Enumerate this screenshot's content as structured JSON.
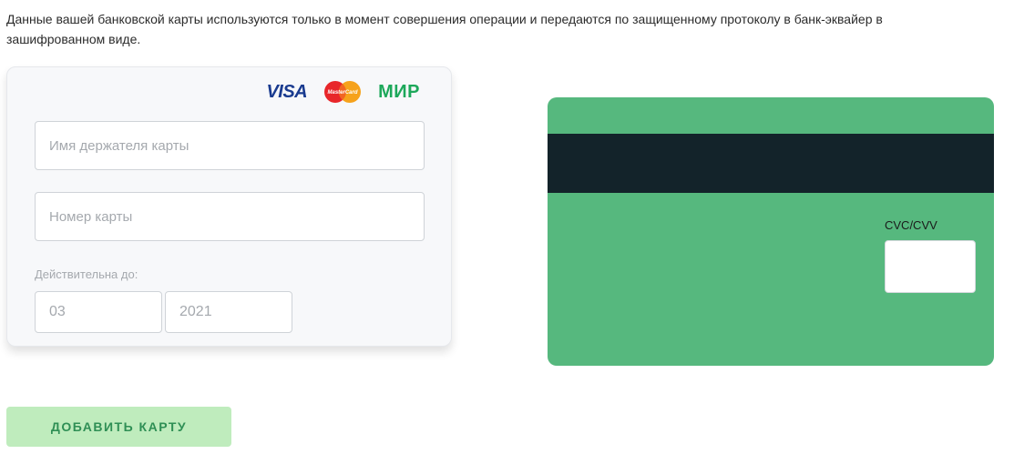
{
  "notice": {
    "text": "Данные вашей банковской карты используются только в момент совершения операции и передаются по защищенному протоколу в банк-эквайер в зашифрованном виде."
  },
  "front_card": {
    "logos": {
      "visa": "VISA",
      "mastercard": "MasterCard",
      "mir": "МИР"
    },
    "holder_field": {
      "placeholder": "Имя держателя карты",
      "value": ""
    },
    "number_field": {
      "placeholder": "Номер карты",
      "value": ""
    },
    "valid_label": "Действительна до:",
    "month_field": {
      "placeholder": "03",
      "value": ""
    },
    "year_field": {
      "placeholder": "2021",
      "value": ""
    }
  },
  "back_card": {
    "cvc_label": "CVC/CVV",
    "cvc_field": {
      "placeholder": "",
      "value": ""
    }
  },
  "add_button": {
    "label": "ДОБАВИТЬ КАРТУ"
  },
  "colors": {
    "card_back": "#56b87e",
    "mag_stripe": "#13232a",
    "button_bg": "#bfecbd",
    "button_text": "#2f8f55"
  }
}
